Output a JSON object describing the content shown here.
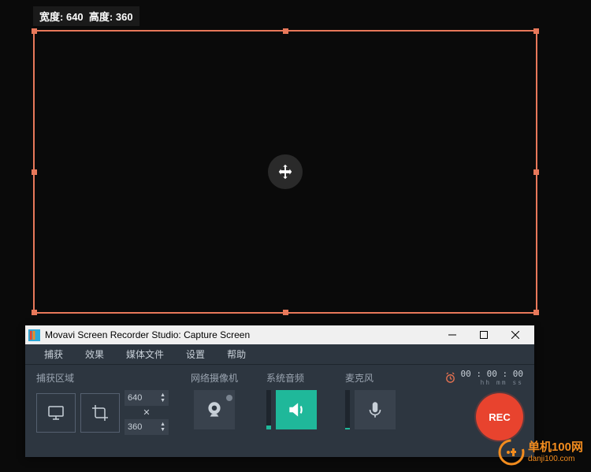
{
  "overlay": {
    "width_label": "宽度:",
    "height_label": "高度:",
    "width_value": "640",
    "height_value": "360"
  },
  "app": {
    "title": "Movavi Screen Recorder Studio: Capture Screen",
    "menu": {
      "capture": "捕获",
      "effects": "效果",
      "media": "媒体文件",
      "settings": "设置",
      "help": "帮助"
    },
    "capture_area_label": "捕获区域",
    "width_input": "640",
    "height_input": "360",
    "webcam_label": "网络摄像机",
    "sysaudio_label": "系统音频",
    "mic_label": "麦克风",
    "timer": "00 : 00 : 00",
    "timer_units": "hh   mm   ss",
    "rec_label": "REC"
  },
  "watermark": {
    "cn": "单机100网",
    "en": "danji100.com"
  }
}
